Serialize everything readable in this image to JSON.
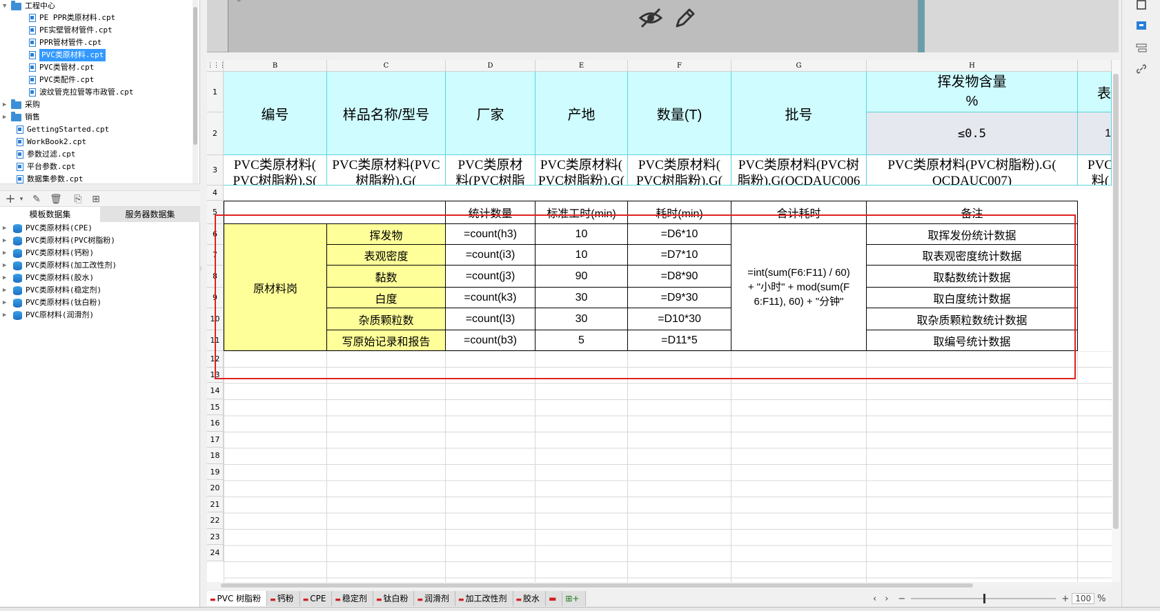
{
  "tree": {
    "root": "工程中心",
    "files": [
      "PE PPR类原材料.cpt",
      "PE实壁管材管件.cpt",
      "PPR管材管件.cpt",
      "PVC类原材料.cpt",
      "PVC类管材.cpt",
      "PVC类配件.cpt",
      "波纹管克拉管等市政管.cpt"
    ],
    "folder2": "采购",
    "folder3": "销售",
    "roots": [
      "GettingStarted.cpt",
      "WorkBook2.cpt",
      "参数过滤.cpt",
      "平台参数.cpt",
      "数据集参数.cpt"
    ]
  },
  "dataset_tabs": [
    "模板数据集",
    "服务器数据集"
  ],
  "datasets": [
    "PVC类原材料(CPE)",
    "PVC类原材料(PVC树脂粉)",
    "PVC类原材料(钙粉)",
    "PVC类原材料(加工改性剂)",
    "PVC类原材料(胶水)",
    "PVC类原材料(稳定剂)",
    "PVC类原材料(钛白粉)",
    "PVC原材料(润滑剂)"
  ],
  "columns": [
    "B",
    "C",
    "D",
    "E",
    "F",
    "G",
    "H"
  ],
  "rows": [
    "1",
    "2",
    "3",
    "4",
    "5",
    "6",
    "7",
    "8",
    "9",
    "10",
    "11",
    "12",
    "13",
    "14",
    "15",
    "16",
    "17",
    "18",
    "19",
    "20",
    "21",
    "22",
    "23",
    "24"
  ],
  "top_zero": "0",
  "header": {
    "b": "编号",
    "c": "样品名称/型号",
    "d": "厂家",
    "e": "产地",
    "f": "数量(T)",
    "g": "批号",
    "h_top": "挥发物含量\n%",
    "h_sub": "≤0.5",
    "i_top": "表",
    "i_sub": "1"
  },
  "row3": {
    "b": "PVC类原材料(\nPVC树脂粉).S(",
    "c": "PVC类原材料(PVC\n树脂粉).G(",
    "d": "PVC类原材\n料(PVC树脂",
    "e": "PVC类原材料(\nPVC树脂粉).G(",
    "f": "PVC类原材料(\nPVC树脂粉).G(",
    "g": "PVC类原材料(PVC树\n脂粉).G(QCDAUC006",
    "h": "PVC类原材料(PVC树脂粉).G(\nQCDAUC007)",
    "i": "PVC\n料("
  },
  "summary": {
    "headers": [
      "统计数量",
      "标准工时(min)",
      "耗时(min)",
      "合计耗时",
      "备注"
    ],
    "group": "原材料岗",
    "items": [
      {
        "name": "挥发物",
        "count": "=count(h3)",
        "std": "10",
        "time": "=D6*10",
        "note": "取挥发份统计数据"
      },
      {
        "name": "表观密度",
        "count": "=count(i3)",
        "std": "10",
        "time": "=D7*10",
        "note": "取表观密度统计数据"
      },
      {
        "name": "黏数",
        "count": "=count(j3)",
        "std": "90",
        "time": "=D8*90",
        "note": "取黏数统计数据"
      },
      {
        "name": "白度",
        "count": "=count(k3)",
        "std": "30",
        "time": "=D9*30",
        "note": "取白度统计数据"
      },
      {
        "name": "杂质颗粒数",
        "count": "=count(l3)",
        "std": "30",
        "time": "=D10*30",
        "note": "取杂质颗粒数统计数据"
      },
      {
        "name": "写原始记录和报告",
        "count": "=count(b3)",
        "std": "5",
        "time": "=D11*5",
        "note": "取编号统计数据"
      }
    ],
    "total_formula": "=int(sum(F6:F11) / 60)\n+ \"小时\" + mod(sum(F\n6:F11), 60) + \"分钟\""
  },
  "sheet_tabs": [
    "PVC 树脂粉",
    "钙粉",
    "CPE",
    "稳定剂",
    "钛白粉",
    "润滑剂",
    "加工改性剂",
    "胶水"
  ],
  "zoom": {
    "value": "100",
    "unit": "%"
  },
  "colors": {
    "header_fill": "#cffcff",
    "label_fill": "#ffff99",
    "highlight": "#e02020",
    "selection": "#3399ff"
  }
}
